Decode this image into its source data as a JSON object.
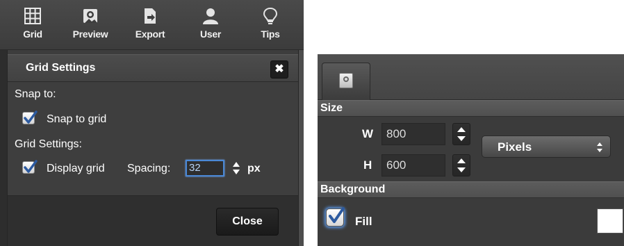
{
  "toolbar": {
    "items": [
      {
        "label": "Grid",
        "icon": "grid-icon"
      },
      {
        "label": "Preview",
        "icon": "preview-icon"
      },
      {
        "label": "Export",
        "icon": "export-icon"
      },
      {
        "label": "User",
        "icon": "user-icon"
      },
      {
        "label": "Tips",
        "icon": "lightbulb-icon"
      }
    ]
  },
  "grid_dialog": {
    "title": "Grid Settings",
    "close_glyph": "✖",
    "snap_heading": "Snap to:",
    "snap_to_grid": {
      "label": "Snap to grid",
      "checked": true
    },
    "grid_heading": "Grid Settings:",
    "display_grid": {
      "label": "Display grid",
      "checked": true
    },
    "spacing_label": "Spacing:",
    "spacing_value": "32",
    "spacing_unit": "px",
    "close_button": "Close"
  },
  "canvas_panel": {
    "tab_icon": "settings-icon",
    "size": {
      "heading": "Size",
      "width_label": "W",
      "width_value": "800",
      "height_label": "H",
      "height_value": "600",
      "unit": "Pixels"
    },
    "background": {
      "heading": "Background",
      "fill_label": "Fill",
      "fill_checked": true,
      "fill_color": "#ffffff"
    }
  },
  "colors": {
    "panel_bg": "#3b3b3b",
    "focus_blue": "#4a88d6",
    "checkmark_blue": "#2c5aa0"
  }
}
